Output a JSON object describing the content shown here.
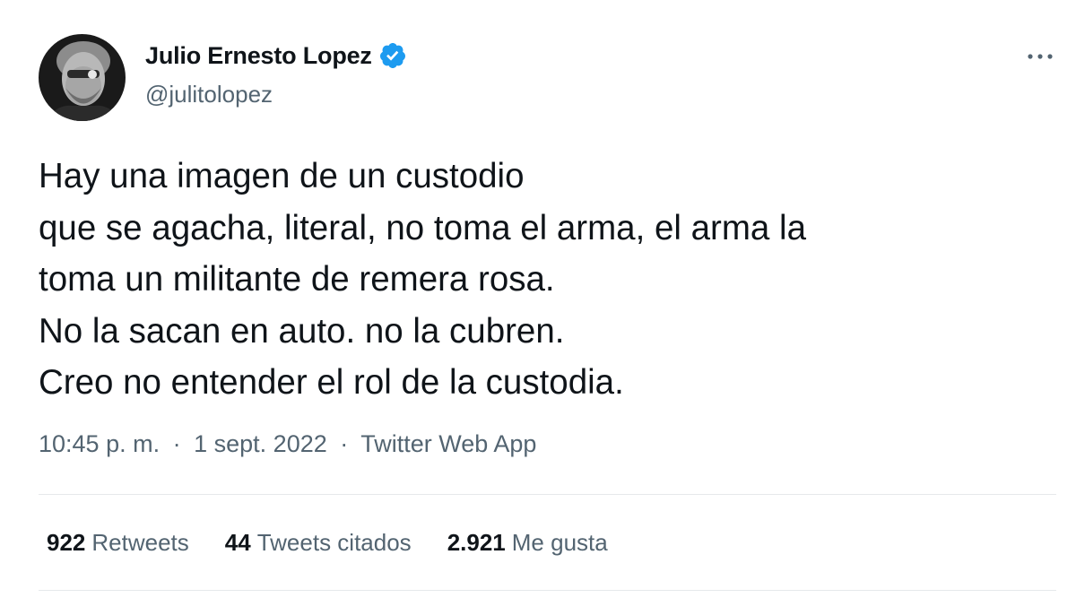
{
  "author": {
    "name": "Julio Ernesto Lopez",
    "handle": "@julitolopez",
    "verified": true,
    "verified_color": "#1d9bf0"
  },
  "tweet": {
    "lines": [
      "Hay una imagen de un custodio",
      "que se agacha, literal, no toma el arma, el arma la",
      "toma un militante de remera rosa.",
      "No la sacan en auto. no la cubren.",
      "Creo no entender el rol de la custodia."
    ],
    "time": "10:45 p. m.",
    "date": "1 sept. 2022",
    "source": "Twitter Web App",
    "separator": "·"
  },
  "stats": {
    "retweets": {
      "count": "922",
      "label": "Retweets"
    },
    "quotes": {
      "count": "44",
      "label": "Tweets citados"
    },
    "likes": {
      "count": "2.921",
      "label": "Me gusta"
    }
  },
  "icons": {
    "more": "more-options-icon",
    "verified": "verified-badge-icon",
    "avatar": "profile-photo"
  },
  "colors": {
    "text": "#0f1419",
    "secondary": "#536471",
    "divider": "#e6e9eb"
  }
}
